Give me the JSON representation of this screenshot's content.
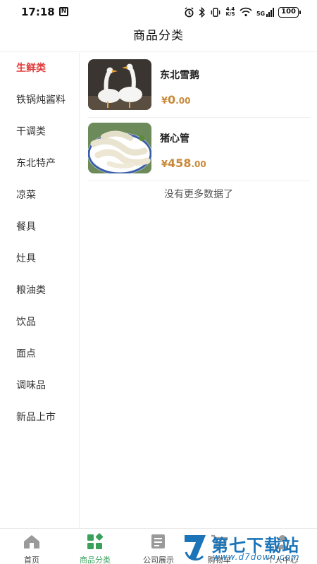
{
  "status_bar": {
    "time": "17:18",
    "nfc": "N",
    "speed_top": "4.4",
    "speed_bottom": "K/S",
    "network": "5G",
    "battery": "100"
  },
  "header": {
    "title": "商品分类"
  },
  "sidebar": {
    "items": [
      {
        "label": "生鲜类",
        "active": true
      },
      {
        "label": "铁锅炖酱料"
      },
      {
        "label": "干调类"
      },
      {
        "label": "东北特产"
      },
      {
        "label": "凉菜"
      },
      {
        "label": "餐具"
      },
      {
        "label": "灶具"
      },
      {
        "label": "粮油类"
      },
      {
        "label": "饮品"
      },
      {
        "label": "面点"
      },
      {
        "label": "调味品"
      },
      {
        "label": "新品上市"
      }
    ]
  },
  "products": [
    {
      "name": "东北雪鹅",
      "currency": "¥",
      "price_int": "0",
      "price_dec": ".00"
    },
    {
      "name": "猪心管",
      "currency": "¥",
      "price_int": "458",
      "price_dec": ".00"
    }
  ],
  "list_end_text": "没有更多数据了",
  "tabbar": {
    "tabs": [
      {
        "label": "首页"
      },
      {
        "label": "商品分类",
        "active": true
      },
      {
        "label": "公司展示"
      },
      {
        "label": "购物车"
      },
      {
        "label": "个人中心"
      }
    ]
  },
  "watermark": {
    "title": "第七下载站",
    "url": "www.d7down.com"
  },
  "colors": {
    "active_category": "#e03b3b",
    "price": "#c8893a",
    "active_tab": "#3aa15a",
    "watermark": "#1b74b8"
  }
}
